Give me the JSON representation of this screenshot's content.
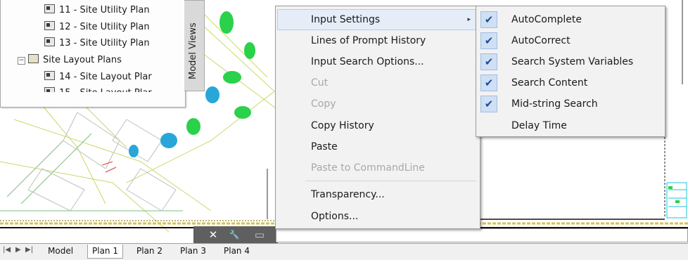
{
  "palette": {
    "items": [
      {
        "label": "11 - Site Utility Plan",
        "type": "sheet"
      },
      {
        "label": "12 - Site Utility Plan",
        "type": "sheet"
      },
      {
        "label": "13 - Site Utility Plan",
        "type": "sheet"
      },
      {
        "label": "Site Layout Plans",
        "type": "folder"
      },
      {
        "label": "14 - Site Layout Plar",
        "type": "sheet"
      },
      {
        "label": "15 - Site Layout Plar",
        "type": "sheet"
      }
    ],
    "side_tab": "Model Views"
  },
  "context_menu": {
    "items": [
      {
        "label": "Input Settings",
        "submenu": true
      },
      {
        "label": "Lines of Prompt History"
      },
      {
        "label": "Input Search Options..."
      },
      {
        "label": "Cut",
        "disabled": true
      },
      {
        "label": "Copy",
        "disabled": true
      },
      {
        "label": "Copy History"
      },
      {
        "label": "Paste"
      },
      {
        "label": "Paste to CommandLine",
        "disabled": true
      },
      {
        "label": "Transparency..."
      },
      {
        "label": "Options..."
      }
    ],
    "submenu_arrow": "▸"
  },
  "submenu": {
    "items": [
      {
        "label": "AutoComplete",
        "checked": true
      },
      {
        "label": "AutoCorrect",
        "checked": true
      },
      {
        "label": "Search System Variables",
        "checked": true
      },
      {
        "label": "Search Content",
        "checked": true
      },
      {
        "label": "Mid-string Search",
        "checked": true
      },
      {
        "label": "Delay Time",
        "checked": false
      }
    ],
    "check_glyph": "✔"
  },
  "command_line": {
    "close_glyph": "✕",
    "wrench_glyph": "🔧",
    "prompt_glyph": "▭"
  },
  "layout_tabs": {
    "nav": [
      "|◀",
      "▶",
      "▶|"
    ],
    "tabs": [
      "Model",
      "Plan 1",
      "Plan 2",
      "Plan 3",
      "Plan 4"
    ],
    "active": "Plan 1"
  },
  "colors": {
    "menu_bg": "#f2f2f2",
    "hover_bg": "#e5edf8",
    "check_bg": "#cfe0f4",
    "disabled_text": "#a8a8a8"
  }
}
